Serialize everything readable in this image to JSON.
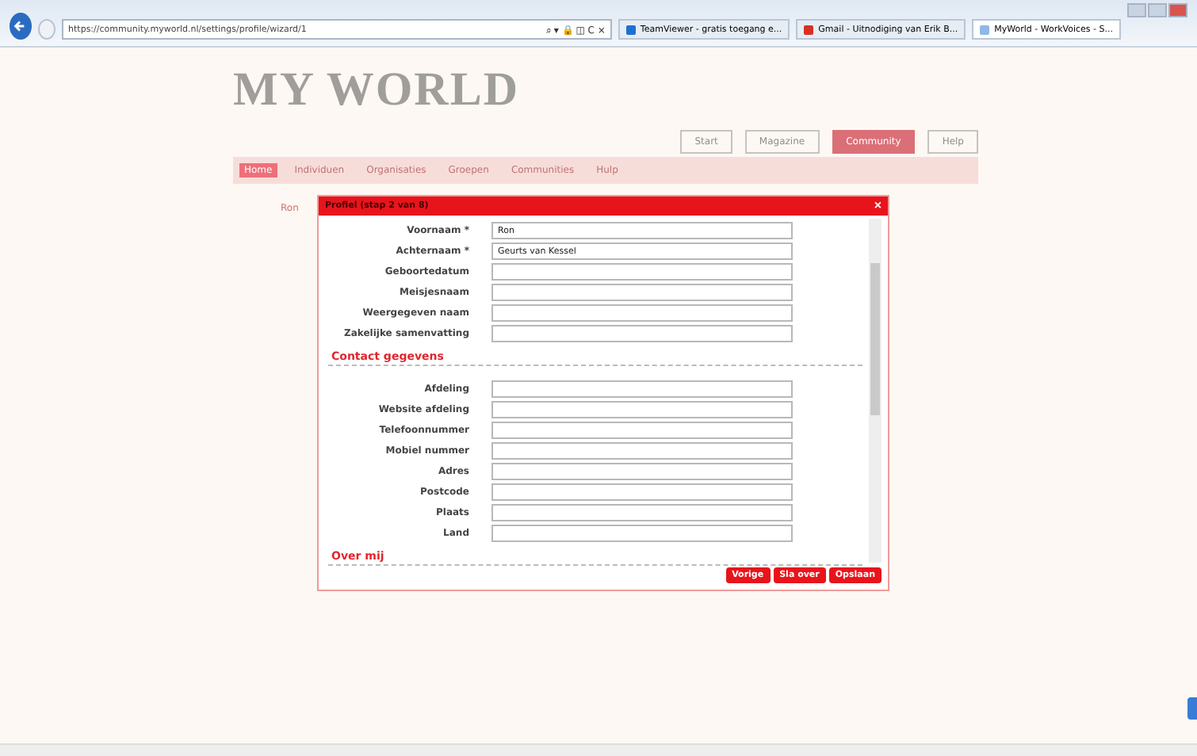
{
  "browser": {
    "url": "https://community.myworld.nl/settings/profile/wizard/1",
    "address_icons": "⌕ ▾ 🔒 ◫ C ×",
    "tabs": [
      {
        "title": "TeamViewer - gratis toegang e...",
        "selected": false,
        "color": "#1f6fd0"
      },
      {
        "title": "Gmail - Uitnodiging van Erik B...",
        "selected": false,
        "color": "#d93025"
      },
      {
        "title": "MyWorld - WorkVoices - S...",
        "selected": true,
        "color": "#8fb8e8"
      }
    ]
  },
  "site": {
    "logo": "MY WORLD",
    "main_nav": [
      {
        "label": "Start",
        "selected": false
      },
      {
        "label": "Magazine",
        "selected": false
      },
      {
        "label": "Community",
        "selected": true
      },
      {
        "label": "Help",
        "selected": false
      }
    ],
    "sub_nav": [
      {
        "label": "Home",
        "selected": true
      },
      {
        "label": "Individuen",
        "selected": false
      },
      {
        "label": "Organisaties",
        "selected": false
      },
      {
        "label": "Groepen",
        "selected": false
      },
      {
        "label": "Communities",
        "selected": false
      },
      {
        "label": "Hulp",
        "selected": false
      }
    ],
    "profile_name": "Ron"
  },
  "dialog": {
    "title": "Profiel (stap 2 van 8)",
    "close": "×",
    "rows": [
      {
        "kind": "field",
        "label": "Voornaam *",
        "value": "Ron"
      },
      {
        "kind": "field",
        "label": "Achternaam *",
        "value": "Geurts van Kessel"
      },
      {
        "kind": "field",
        "label": "Geboortedatum"
      },
      {
        "kind": "field",
        "label": "Meisjesnaam"
      },
      {
        "kind": "field",
        "label": "Weergegeven naam"
      },
      {
        "kind": "field",
        "label": "Zakelijke samenvatting"
      },
      {
        "kind": "section",
        "label": "Contact gegevens"
      },
      {
        "kind": "field",
        "label": "Afdeling"
      },
      {
        "kind": "field",
        "label": "Website afdeling"
      },
      {
        "kind": "field",
        "label": "Telefoonnummer"
      },
      {
        "kind": "field",
        "label": "Mobiel nummer"
      },
      {
        "kind": "field",
        "label": "Adres"
      },
      {
        "kind": "field",
        "label": "Postcode"
      },
      {
        "kind": "field",
        "label": "Plaats"
      },
      {
        "kind": "field",
        "label": "Land"
      },
      {
        "kind": "section",
        "label": "Over mij"
      }
    ],
    "buttons": [
      "Vorige",
      "Sla over",
      "Opslaan"
    ]
  }
}
